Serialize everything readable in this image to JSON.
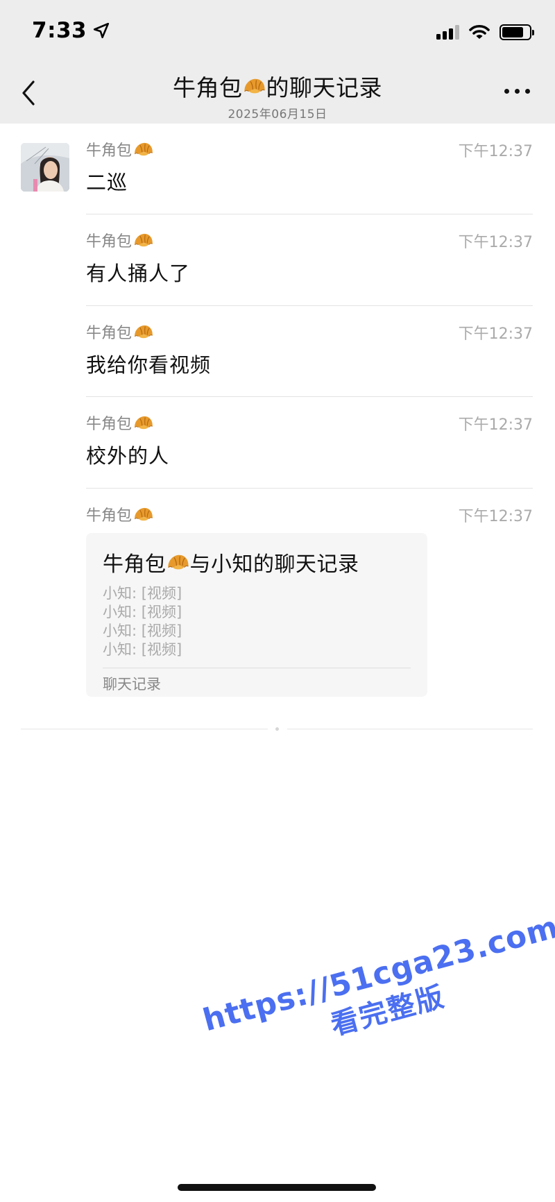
{
  "status_bar": {
    "time": "7:33"
  },
  "header": {
    "back_icon": "chevron-left-icon",
    "title_prefix": "牛角包",
    "title_suffix": "的聊天记录",
    "date": "2025年06月15日",
    "more_icon": "more-dots-icon"
  },
  "messages": [
    {
      "sender": "牛角包",
      "time": "下午12:37",
      "text": "二巡"
    },
    {
      "sender": "牛角包",
      "time": "下午12:37",
      "text": "有人捅人了"
    },
    {
      "sender": "牛角包",
      "time": "下午12:37",
      "text": "我给你看视频"
    },
    {
      "sender": "牛角包",
      "time": "下午12:37",
      "text": "校外的人"
    },
    {
      "sender": "牛角包",
      "time": "下午12:37",
      "card": {
        "title_prefix": "牛角包",
        "title_suffix": "与小知的聊天记录",
        "lines": [
          "小知: [视频]",
          "小知: [视频]",
          "小知: [视频]",
          "小知: [视频]"
        ],
        "footer": "聊天记录"
      }
    }
  ],
  "watermark": {
    "url": "https://51cga23.com",
    "subtitle": "看完整版"
  },
  "colors": {
    "header_bg": "#ededed",
    "watermark": "#4b6ff0",
    "card_bg": "#f6f6f6"
  }
}
